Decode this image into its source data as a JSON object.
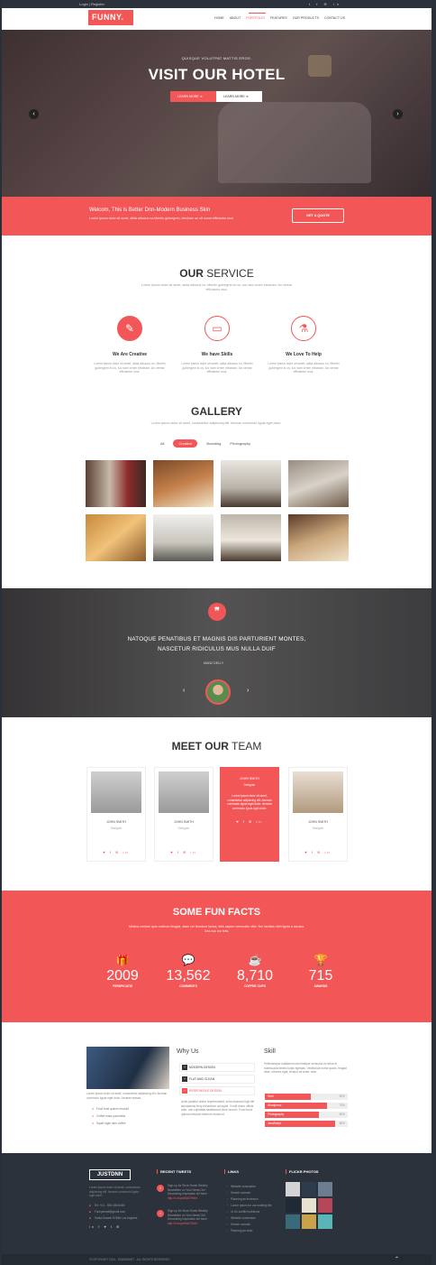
{
  "topbar": {
    "left": "Login | Register",
    "right": "t f ⊕ in"
  },
  "header": {
    "logo": "FUNNY.",
    "nav": [
      "HOME",
      "ABOUT",
      "PORTFOLIO",
      "FEATURES",
      "OUR PRODUCTS",
      "CONTACT US"
    ]
  },
  "hero": {
    "subtitle": "QUISQUE VOLUTPAT MATTIS EROS.",
    "title": "VISIT OUR HOTEL",
    "btn1": "LEARN MORE",
    "btn2": "LEARN MORE"
  },
  "banner": {
    "title": "Welcom, This is Better Dnn-Modern Business Skin",
    "text": "Lorem ipsum dolor sit amet, alida albucus no.Mentin gubergren, electram an sit nonai efficiantur usui",
    "button": "GET A QUOTE"
  },
  "service": {
    "title_bold": "OUR",
    "title_rest": " SERVICE",
    "text": "Lorem ipsum dolor sit amet, alida albucus no. Mentin gubergren in us, ius nam ornen electram. An verear efficiantur usui.",
    "items": [
      {
        "title": "We Are Creative",
        "text": "Lorem ipsum dolor sit amet, alida albucus no. Mentin gubergren in us, ius nam ornen electram. An verear efficiantur usui."
      },
      {
        "title": "We have Skills",
        "text": "Lorem ipsum dolor sit amet, alida albucus no. Mentin gubergren in us, ius nam ornen electram. An verear efficiantur usui."
      },
      {
        "title": "We Love To Help",
        "text": "Lorem ipsum dolor sit amet, alida albucus no. Mentin gubergren in us, ius nam ornen electram. An verear efficiantur usui."
      }
    ]
  },
  "gallery": {
    "title": "GALLERY",
    "text": "Lorem ipsum dolor sit amet, consectetur adipiscing elit. Aenean commodo ligula eget dolor.",
    "filters": [
      "All",
      "Creative",
      "Branding",
      "Photography"
    ]
  },
  "testimonial": {
    "quote_line1": "NATOQUE PENATIBUS ET MAGNIS DIS PARTURIENT MONTES,",
    "quote_line2": "NASCETUR RIDICULUS MUS NULLA DUIF",
    "name": "MANZ DELLY"
  },
  "team": {
    "title_bold": "MEET OUR",
    "title_rest": " TEAM",
    "members": [
      {
        "name": "JOHN SMITH",
        "role": "Designer"
      },
      {
        "name": "JOHN SMITH",
        "role": "Designer"
      },
      {
        "name": "JOHN SMITH",
        "role": "Designer",
        "desc": "Lorem ipsum dolor sit amet, consectetur adipiscing elit. Aenean commodo ligula eget dolor. Aenean commodo ligula eget dolor."
      },
      {
        "name": "JOHN SMITH",
        "role": "Designer"
      }
    ],
    "social": "♥ f ⊕ in"
  },
  "facts": {
    "title": "SOME FUN FACTS",
    "text": "Minima veniam quis nostrum feugiat, diam vel tincidunt luctus, felis sapien venenatis nibh. Nm facilisis nibh ligula a iaculus. Sed non leo felis.",
    "items": [
      {
        "icon": "gift-icon",
        "glyph": "🎁",
        "num": "2009",
        "label": "PERSPICATIS"
      },
      {
        "icon": "chat-icon",
        "glyph": "💬",
        "num": "13,562",
        "label": "COMMENTS"
      },
      {
        "icon": "coffee-icon",
        "glyph": "☕",
        "num": "8,710",
        "label": "COFFEE CUPS"
      },
      {
        "icon": "trophy-icon",
        "glyph": "🏆",
        "num": "715",
        "label": "AWARDS"
      }
    ]
  },
  "about": {
    "text": "Lorem ipsum dolor sit amet, consectetur adipiscing elit. Aenean commodo ligula eget dolor. Aenean massa.",
    "list": [
      "Food trust quinex resould",
      "Coffee mala poundrela",
      "Squirt ingle nam coffee"
    ],
    "why_title": "Why Us",
    "accordion": [
      "MODERN DESIGN",
      "FLAT AND CLEAN",
      "RESPONSIVE DESIGN"
    ],
    "acc_text": "Anim pariatur cliche reprehenderit, enim eiusmod high life accusamus terry richardson ad squid. 3 wolf moon officia aute, non cupidatat skateboard dolor brunch. Food truck quinoa nesciunt laborum eiusmod.",
    "skill_title": "Skill",
    "skill_text": "Pellentesque habitant morbi tristique senectus et netus et malesuada fames turpis egestas. Vestibulum tortor quam, feugiat vitae, ultricies eget, tempor sit amet, ante.",
    "skills": [
      {
        "name": "Html",
        "value": 55,
        "label": "55%"
      },
      {
        "name": "Wordpress",
        "value": 75,
        "label": "75%"
      },
      {
        "name": "Photography",
        "value": 65,
        "label": "65%"
      },
      {
        "name": "JavaScript",
        "value": 85,
        "label": "85%"
      }
    ]
  },
  "footer": {
    "logo": "JUSTDNN",
    "text": "Lorem ipsum dolor sit amet, consectetur adipiscing elit. Aenean commodo ligula eget dolor.",
    "contacts": [
      "Tel: +01 - 555 456 8469",
      "Funnyemail@gmail.com",
      "Santa Drawer 87646 Los Angeles"
    ],
    "social": "in f ♥ t ⊕",
    "tweets_title": "RECENT TWEETS",
    "tweets": [
      {
        "text": "Sign up for Shoe Home Weekly Newsletter on Your News Get Decorating Inspiration at Home",
        "link": "http://t.co/pxd5a07hMrx"
      },
      {
        "text": "Sign up for Shoe Home Weekly Newsletter on Your News Get Decorating Inspiration at Home",
        "link": "http://t.co/pxd5a07hMrx"
      }
    ],
    "links_title": "LINKS",
    "links": [
      "Website conception",
      "Search console",
      "Planning an inversion",
      "Lorem ipsum for our building tile",
      "Ui Ux conflict solutions",
      "Website conversion",
      "Search console",
      "Planning an solid"
    ],
    "flickr_title": "FLICKR PHOTOS",
    "copyright": "©COPYRIGHT 2014 - DNNSMART - ALL RIGHTS RESERVED"
  },
  "colors": {
    "accent": "#f35657",
    "dark": "#2b323c"
  }
}
